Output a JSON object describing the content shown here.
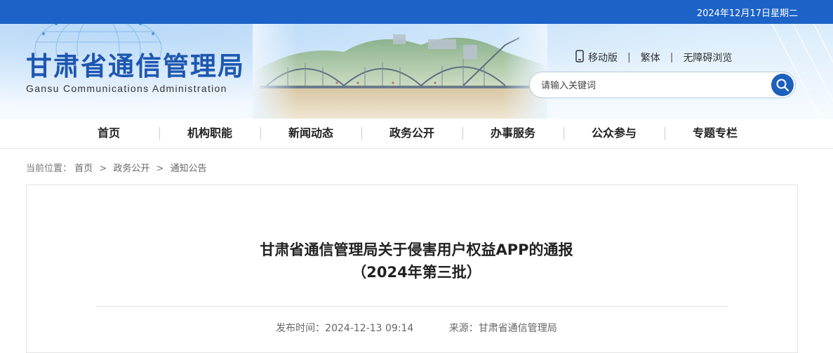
{
  "topbar": {
    "date": "2024年12月17日星期二"
  },
  "header": {
    "logo_cn": "甘肃省通信管理局",
    "logo_en": "Gansu Communications Administration",
    "links": {
      "mobile": "移动版",
      "traditional": "繁体",
      "accessible": "无障碍浏览"
    },
    "search": {
      "placeholder": "请输入关键词"
    }
  },
  "nav": {
    "items": [
      "首页",
      "机构职能",
      "新闻动态",
      "政务公开",
      "办事服务",
      "公众参与",
      "专题专栏"
    ]
  },
  "breadcrumb": {
    "prefix": "当前位置：",
    "items": [
      "首页",
      "政务公开",
      "通知公告"
    ]
  },
  "article": {
    "title_line1": "甘肃省通信管理局关于侵害用户权益APP的通报",
    "title_line2": "（2024年第三批）",
    "publish": "发布时间：2024-12-13 09:14",
    "source": "来源：甘肃省通信管理局"
  },
  "colors": {
    "topbar": "#1d63c7",
    "logo": "#1e57b0",
    "search_button": "#1d5fbc"
  }
}
